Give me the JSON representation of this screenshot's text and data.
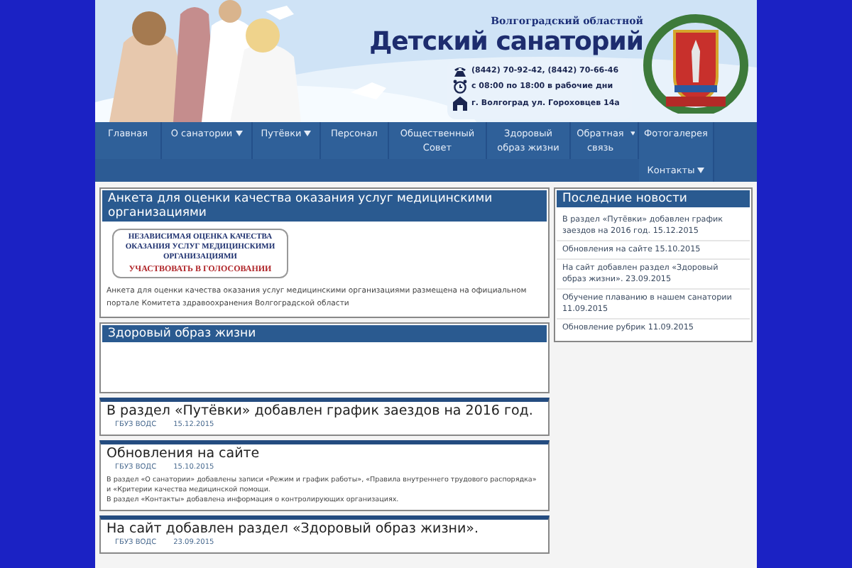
{
  "header": {
    "subtitle": "Волгоградский областной",
    "title": "Детский санаторий",
    "contacts": [
      {
        "kind": "phone",
        "text": "(8442) 70-92-42, (8442) 70-66-46"
      },
      {
        "kind": "clock",
        "text": "с 08:00 по 18:00 в рабочие дни"
      },
      {
        "kind": "address",
        "text": "г. Волгоград ул. Гороховцев 14а"
      }
    ]
  },
  "nav": [
    {
      "label": "Главная",
      "has_menu": false
    },
    {
      "label": "О санатории",
      "has_menu": true
    },
    {
      "label": "Путёвки",
      "has_menu": true
    },
    {
      "label": "Персонал",
      "has_menu": false
    },
    {
      "label": "Общественный Совет",
      "has_menu": false
    },
    {
      "label": "Здоровый образ жизни",
      "has_menu": false
    },
    {
      "label": "Обратная связь",
      "has_menu": true
    },
    {
      "label": "Фотогалерея",
      "has_menu": false
    },
    {
      "label": "Контакты",
      "has_menu": true
    }
  ],
  "survey": {
    "title": "Анкета для оценки качества оказания услуг медицинскими организациями",
    "banner_lines": [
      "НЕЗАВИСИМАЯ ОЦЕНКА КАЧЕСТВА",
      "ОКАЗАНИЯ УСЛУГ МЕДИЦИНСКИМИ",
      "ОРГАНИЗАЦИЯМИ"
    ],
    "banner_link": "УЧАСТВОВАТЬ В ГОЛОСОВАНИИ",
    "text": "Анкета для оценки качества оказания услуг медицинскими организациями размещена на официальном портале Комитета здравоохранения Волгоградской области"
  },
  "health": {
    "title": "Здоровый образ жизни"
  },
  "posts": [
    {
      "title": "В раздел «Путёвки» добавлен график заездов на 2016 год.",
      "author": "ГБУЗ ВОДС",
      "date": "15.12.2015"
    },
    {
      "title": "Обновления на сайте",
      "author": "ГБУЗ ВОДС",
      "date": "15.10.2015",
      "body": [
        "В раздел «О санатории» добавлены  записи «Режим и график работы»,  «Правила внутреннего трудового распорядка» и «Критерии качества медицинской помощи.",
        "В раздел  «Контакты» добавлена информация о контролирующих организациях."
      ]
    },
    {
      "title": "На сайт добавлен раздел «Здоровый образ жизни».",
      "author": "ГБУЗ ВОДС",
      "date": "23.09.2015"
    }
  ],
  "news": {
    "title": "Последние новости",
    "items": [
      "В раздел «Путёвки» добавлен график заездов на 2016 год. 15.12.2015",
      "Обновления на сайте 15.10.2015",
      "На сайт добавлен раздел «Здоровый образ жизни». 23.09.2015",
      "Обучение плаванию в нашем санатории 11.09.2015",
      "Обновление рубрик 11.09.2015"
    ]
  }
}
